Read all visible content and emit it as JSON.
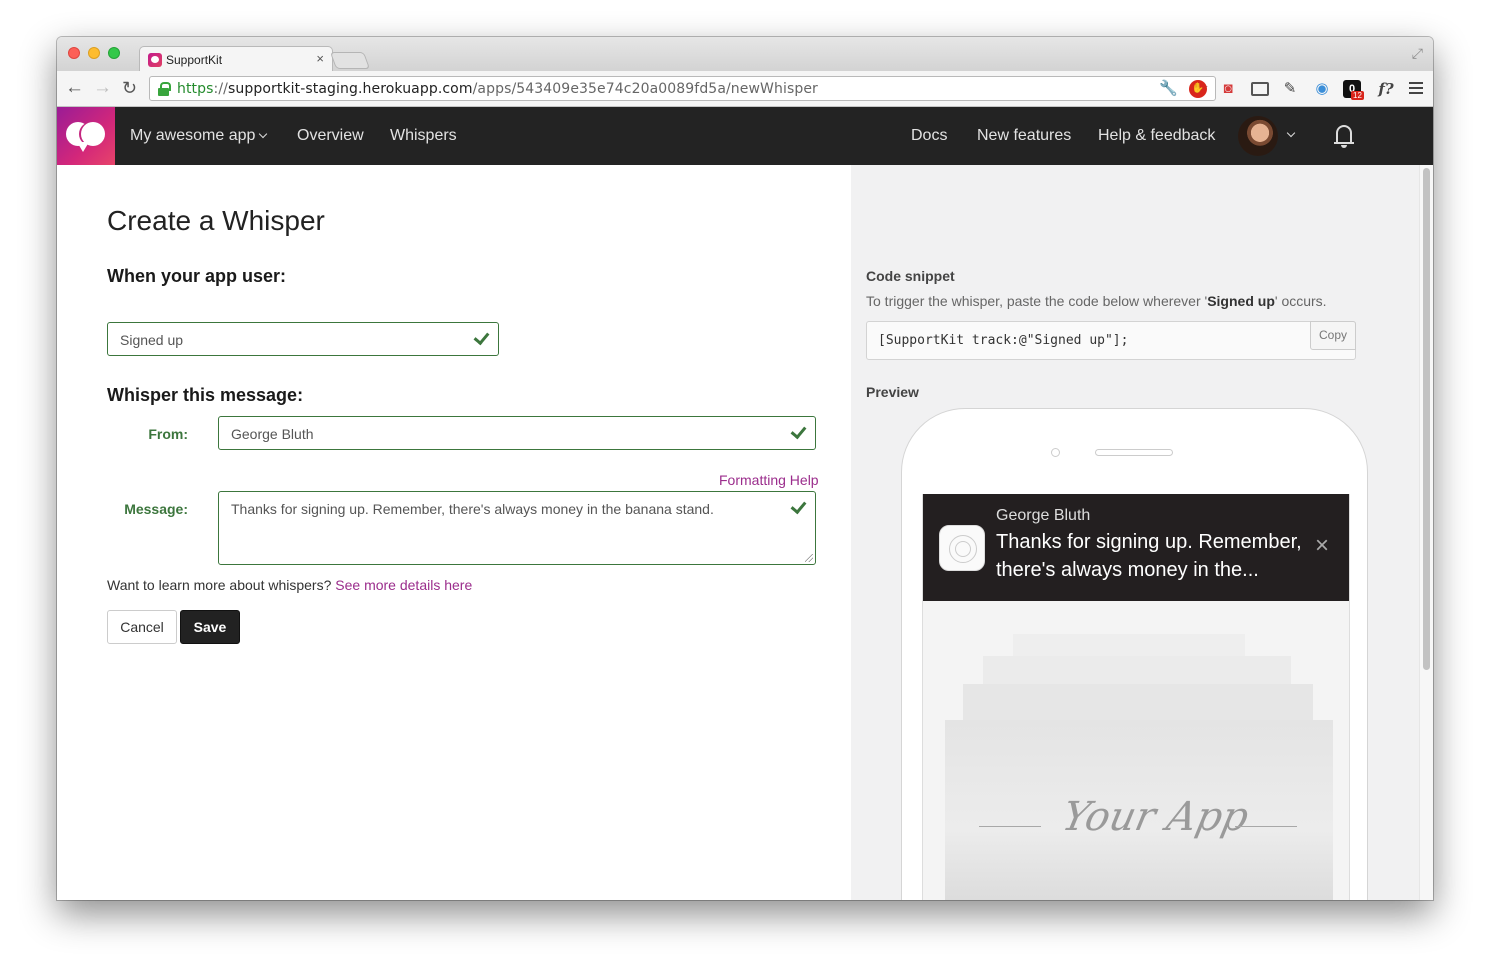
{
  "browser": {
    "tab_title": "SupportKit",
    "tab_close": "×",
    "url_scheme": "https",
    "url_sep": "://",
    "url_host": "supportkit-staging.herokuapp.com",
    "url_path": "/apps/543409e35e74c20a0089fd5a/newWhisper",
    "back": "←",
    "forward": "→",
    "reload": "↻",
    "star": "☆",
    "fullscreen": "⤢",
    "extensions": [
      "wrench-icon",
      "adblock-icon",
      "record-icon",
      "cast-icon",
      "eyedropper-icon",
      "camera-icon",
      "password-icon",
      "font-icon"
    ],
    "ext_font_label": "f?",
    "ext_badge": "12"
  },
  "appnav": {
    "app_selector": "My awesome app",
    "links_left": [
      "Overview",
      "Whispers"
    ],
    "links_right": [
      "Docs",
      "New features",
      "Help & feedback"
    ]
  },
  "form": {
    "title": "Create a Whisper",
    "when_heading": "When your app user:",
    "event_value": "Signed up",
    "whisper_heading": "Whisper this message:",
    "from_label": "From:",
    "from_value": "George Bluth",
    "formatting_help": "Formatting Help",
    "message_label": "Message:",
    "message_value": "Thanks for signing up. Remember, there's always money in the banana stand.",
    "learn_more_text": "Want to learn more about whispers?",
    "learn_more_link": "See more details here",
    "cancel": "Cancel",
    "save": "Save"
  },
  "snippet": {
    "heading": "Code snippet",
    "desc_before": "To trigger the whisper, paste the code below wherever '",
    "desc_event": "Signed up",
    "desc_after": "' occurs.",
    "code": "[SupportKit track:@\"Signed up\"];",
    "copy": "Copy"
  },
  "preview": {
    "heading": "Preview",
    "sender": "George Bluth",
    "text": "Thanks for signing up. Remember, there's always money in the...",
    "close": "×",
    "placeholder_app": "Your App"
  },
  "colors": {
    "navbar": "#232323",
    "brand_start": "#9a1c96",
    "brand_end": "#e7446a",
    "success": "#3c763d",
    "link": "#9b2d8c"
  }
}
